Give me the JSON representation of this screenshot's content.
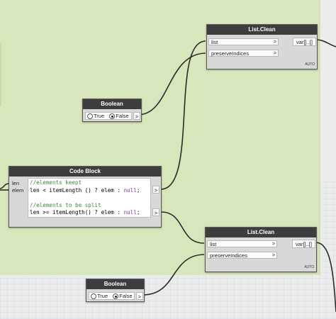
{
  "colors": {
    "group_bg": "#d8e6bc",
    "wire": "#2a2a2a",
    "header": "#3d3d3d",
    "comment": "#3b8a3b",
    "keyword": "#7b3aa0"
  },
  "listclean_top": {
    "title": "List.Clean",
    "inputs": [
      "list",
      "preserveIndices"
    ],
    "output": "var[]..[]",
    "lacing": "AUTO"
  },
  "boolean_top": {
    "title": "Boolean",
    "option_true": "True",
    "option_false": "False",
    "selected": "False",
    "output_icon": ">"
  },
  "code_block": {
    "title": "Code Block",
    "inputs": [
      "len",
      "elem"
    ],
    "lines": {
      "comment1": "//elements keept",
      "line1": "len < itemLength () ? elem : ",
      "null1": "null",
      "end1": ";",
      "comment2": "//elements to be split",
      "line2": "len >= itemLength() ? elem : ",
      "null2": "null",
      "end2": ";"
    }
  },
  "listclean_bottom": {
    "title": "List.Clean",
    "inputs": [
      "list",
      "preserveIndices"
    ],
    "output": "var[]..[]",
    "lacing": "AUTO"
  },
  "boolean_bottom": {
    "title": "Boolean",
    "option_true": "True",
    "option_false": "False",
    "selected": "False",
    "output_icon": ">"
  },
  "port_arrow": ">"
}
